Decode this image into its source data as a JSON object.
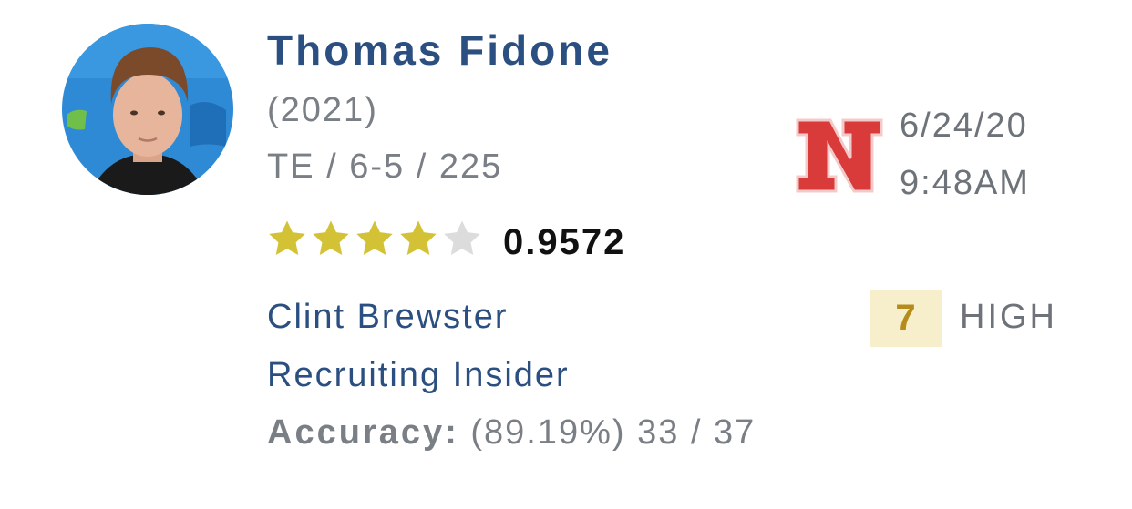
{
  "player": {
    "name": "Thomas Fidone",
    "class_year": "(2021)",
    "position_measurables": "TE / 6-5 / 225",
    "stars": 4,
    "max_stars": 5,
    "rating": "0.9572",
    "avatar_icon": "player-headshot"
  },
  "prediction": {
    "school_logo_icon": "nebraska-n-logo",
    "date": "6/24/20",
    "time": "9:48AM",
    "confidence_value": "7",
    "confidence_label": "HIGH"
  },
  "analyst": {
    "name": "Clint Brewster",
    "title": "Recruiting Insider",
    "accuracy_label": "Accuracy:",
    "accuracy_value": "(89.19%) 33 / 37"
  },
  "colors": {
    "name_blue": "#2b4f80",
    "star_filled": "#d4c236",
    "star_empty": "#dcdcdc",
    "logo_red": "#d93a3a",
    "confidence_bg": "#f7efcb",
    "confidence_text": "#b58c1c"
  }
}
